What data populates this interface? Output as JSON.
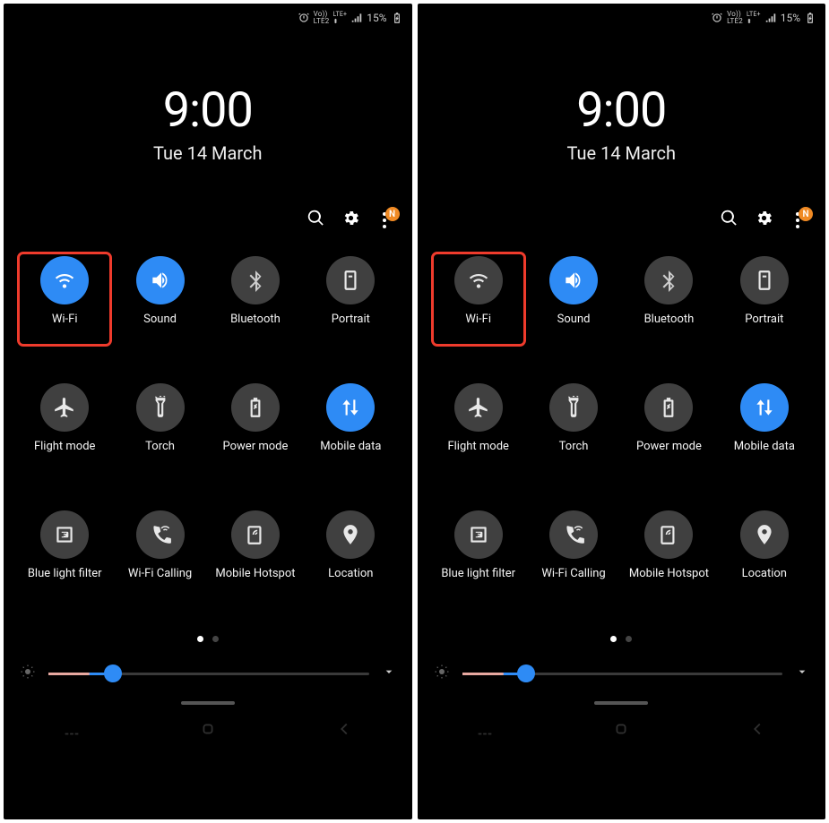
{
  "statusBar": {
    "carrierTop": "Vo))",
    "carrierBot": "LTE2",
    "lteTop": "LTE+",
    "battery": "15%"
  },
  "clock": {
    "time": "9:00",
    "date": "Tue 14 March"
  },
  "moreBadge": "N",
  "tiles": [
    {
      "id": "wifi",
      "label": "Wi-Fi"
    },
    {
      "id": "sound",
      "label": "Sound"
    },
    {
      "id": "bluetooth",
      "label": "Bluetooth"
    },
    {
      "id": "portrait",
      "label": "Portrait"
    },
    {
      "id": "flight",
      "label": "Flight mode"
    },
    {
      "id": "torch",
      "label": "Torch"
    },
    {
      "id": "power",
      "label": "Power mode"
    },
    {
      "id": "mobiledata",
      "label": "Mobile data"
    },
    {
      "id": "bluelight",
      "label": "Blue light filter"
    },
    {
      "id": "wificalling",
      "label": "Wi-Fi Calling"
    },
    {
      "id": "hotspot",
      "label": "Mobile Hotspot"
    },
    {
      "id": "location",
      "label": "Location"
    }
  ],
  "panels": [
    {
      "wifiActive": true,
      "brightnessPct": 20
    },
    {
      "wifiActive": false,
      "brightnessPct": 20
    }
  ],
  "activeCommon": {
    "sound": true,
    "mobiledata": true
  }
}
